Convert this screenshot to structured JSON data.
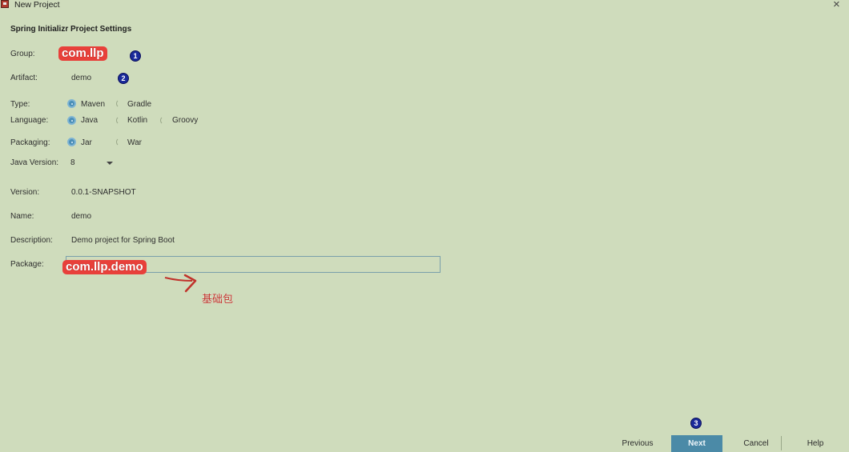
{
  "window": {
    "title": "New Project",
    "close_icon": "×"
  },
  "section_title": "Spring Initializr Project Settings",
  "fields": {
    "group": {
      "label": "Group:",
      "value": "com.llp"
    },
    "artifact": {
      "label": "Artifact:",
      "value": "demo"
    },
    "type": {
      "label": "Type:",
      "options": [
        "Maven",
        "Gradle"
      ],
      "selected": "Maven"
    },
    "language": {
      "label": "Language:",
      "options": [
        "Java",
        "Kotlin",
        "Groovy"
      ],
      "selected": "Java"
    },
    "packaging": {
      "label": "Packaging:",
      "options": [
        "Jar",
        "War"
      ],
      "selected": "Jar"
    },
    "java_version": {
      "label": "Java Version:",
      "value": "8"
    },
    "version": {
      "label": "Version:",
      "value": "0.0.1-SNAPSHOT"
    },
    "name": {
      "label": "Name:",
      "value": "demo"
    },
    "description": {
      "label": "Description:",
      "value": "Demo project for Spring Boot"
    },
    "package": {
      "label": "Package:",
      "value": "com.llp.demo"
    }
  },
  "annotations": {
    "step1": "1",
    "step2": "2",
    "step3": "3",
    "package_note": "基础包",
    "annotation_color": "#e8403a",
    "badge_color": "#1a2a9a"
  },
  "footer": {
    "previous_label": "Previous",
    "next_label": "Next",
    "cancel_label": "Cancel",
    "help_label": "Help"
  },
  "colors": {
    "background": "#cfdcbc",
    "accent": "#4b8aa7",
    "radio_selected": "#4b8fb8"
  }
}
